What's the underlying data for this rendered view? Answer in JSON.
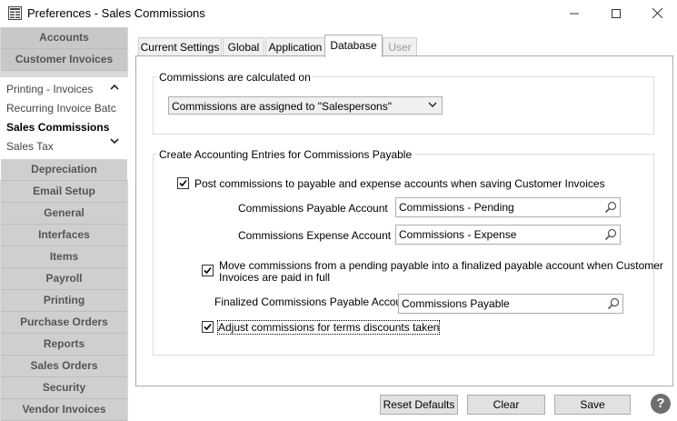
{
  "window": {
    "title": "Preferences - Sales Commissions",
    "minimize_glyph": "—",
    "maximize_glyph": "☐",
    "close_glyph": "✕"
  },
  "sidebar": {
    "top_items": [
      {
        "label": "Accounts"
      },
      {
        "label": "Customer Invoices"
      }
    ],
    "sub_items": [
      {
        "label": "Printing - Invoices"
      },
      {
        "label": "Recurring Invoice Batc..."
      },
      {
        "label": "Sales Commissions"
      },
      {
        "label": "Sales Tax"
      }
    ],
    "bottom_items": [
      {
        "label": "Depreciation"
      },
      {
        "label": "Email Setup"
      },
      {
        "label": "General"
      },
      {
        "label": "Interfaces"
      },
      {
        "label": "Items"
      },
      {
        "label": "Payroll"
      },
      {
        "label": "Printing"
      },
      {
        "label": "Purchase Orders"
      },
      {
        "label": "Reports"
      },
      {
        "label": "Sales Orders"
      },
      {
        "label": "Security"
      },
      {
        "label": "Vendor Invoices"
      }
    ]
  },
  "tabs": [
    {
      "label": "Current Settings"
    },
    {
      "label": "Global"
    },
    {
      "label": "Application"
    },
    {
      "label": "Database"
    },
    {
      "label": "User"
    }
  ],
  "calc_group": {
    "title": "Commissions are calculated on",
    "selected": "Commissions are assigned to \"Salespersons\""
  },
  "entries_group": {
    "title": "Create Accounting Entries for Commissions Payable",
    "post_checkbox": {
      "label": "Post commissions to payable and expense accounts when saving Customer Invoices",
      "checked": true
    },
    "payable_account": {
      "label": "Commissions Payable Account",
      "value": "Commissions - Pending"
    },
    "expense_account": {
      "label": "Commissions Expense Account",
      "value": "Commissions - Expense"
    },
    "move_checkbox": {
      "label_line1": "Move commissions from a pending payable into a finalized payable account when Customer",
      "label_line2": "Invoices are paid in full",
      "checked": true
    },
    "finalized_account": {
      "label": "Finalized Commissions Payable Account",
      "value": "Commissions Payable"
    },
    "adjust_checkbox": {
      "label": "Adjust commissions for terms discounts taken",
      "checked": true
    }
  },
  "buttons": {
    "reset": "Reset Defaults",
    "clear": "Clear",
    "save": "Save",
    "help": "?"
  }
}
